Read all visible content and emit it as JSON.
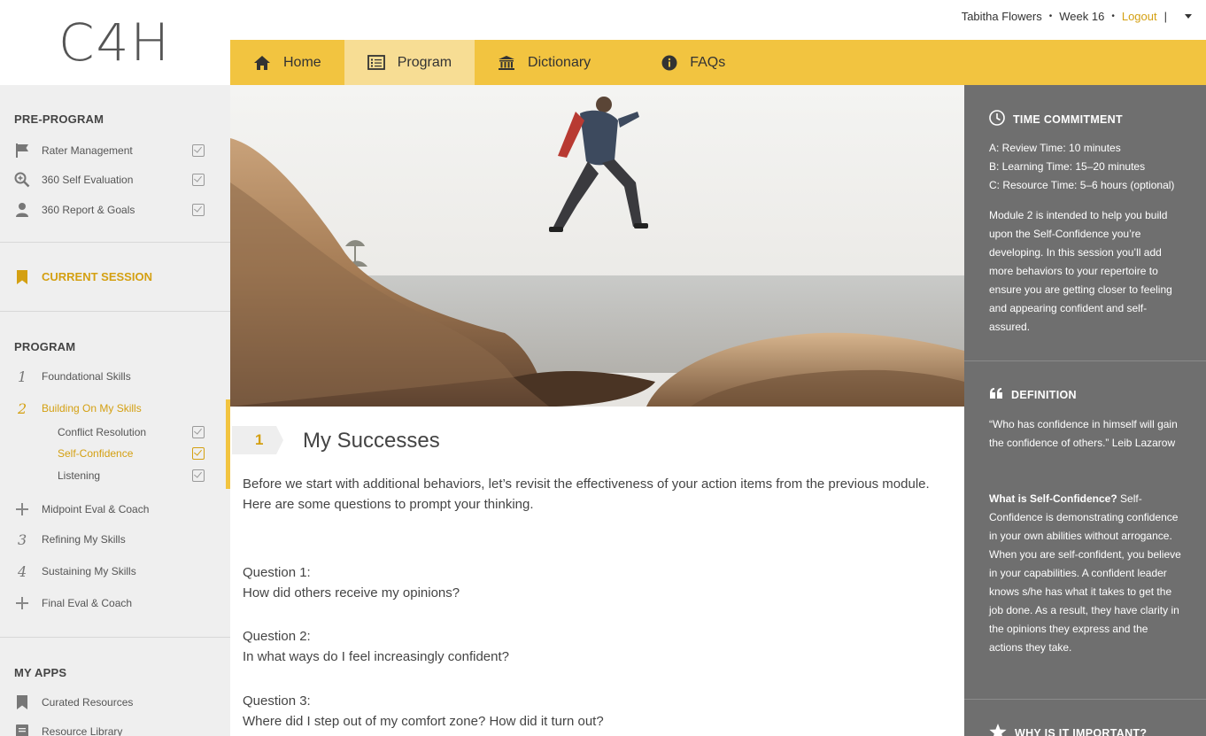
{
  "app": {
    "logo": "C4H"
  },
  "user": {
    "name": "Tabitha Flowers",
    "sep": "•",
    "week": "Week 16",
    "logout": "Logout",
    "pipe": "|"
  },
  "nav": {
    "tabs": [
      {
        "label": "Home",
        "icon": "home-icon"
      },
      {
        "label": "Program",
        "icon": "list-icon",
        "active": true
      },
      {
        "label": "Dictionary",
        "icon": "museum-icon"
      },
      {
        "label": "FAQs",
        "icon": "info-icon"
      }
    ]
  },
  "sidebar": {
    "pre_program": {
      "title": "PRE-PROGRAM",
      "items": [
        {
          "label": "Rater Management",
          "icon": "flag-icon",
          "done": true
        },
        {
          "label": "360 Self Evaluation",
          "icon": "magnifier-icon",
          "done": true
        },
        {
          "label": "360 Report & Goals",
          "icon": "person-icon",
          "done": true
        }
      ]
    },
    "current_session": "CURRENT SESSION",
    "program": {
      "title": "PROGRAM",
      "items": [
        {
          "num": "1",
          "label": "Foundational Skills"
        },
        {
          "num": "2",
          "label": "Building On My Skills",
          "active": true,
          "subitems": [
            {
              "label": "Conflict Resolution",
              "done": true
            },
            {
              "label": "Self-Confidence",
              "done": true,
              "active": true
            },
            {
              "label": "Listening",
              "done": true
            }
          ]
        },
        {
          "num": "+",
          "label": "Midpoint Eval & Coach"
        },
        {
          "num": "3",
          "label": "Refining My Skills"
        },
        {
          "num": "4",
          "label": "Sustaining My Skills"
        },
        {
          "num": "+",
          "label": "Final Eval & Coach"
        }
      ]
    },
    "my_apps": {
      "title": "MY APPS",
      "items": [
        {
          "label": "Curated Resources",
          "icon": "bookmark-icon"
        },
        {
          "label": "Resource Library",
          "icon": "book-icon"
        }
      ]
    }
  },
  "main": {
    "section_number": "1",
    "section_title": "My Successes",
    "intro": "Before we start with additional behaviors, let’s revisit the effectiveness of your action items from the previous module. Here are some questions to prompt your thinking.",
    "questions": [
      {
        "label": "Question 1:",
        "text": "How did others receive my opinions?"
      },
      {
        "label": "Question 2:",
        "text": "In what ways do I feel increasingly confident?"
      },
      {
        "label": "Question 3:",
        "text": "Where did I step out of my comfort zone? How did it turn out?"
      }
    ]
  },
  "panel": {
    "time": {
      "title": "TIME COMMITMENT",
      "lines": [
        "A: Review Time: 10 minutes",
        "B: Learning Time: 15–20 minutes",
        "C: Resource Time: 5–6 hours (optional)"
      ],
      "desc": "Module 2 is intended to help you build upon the Self-Confidence you’re developing. In this session you’ll add more behaviors to your repertoire to ensure you are getting closer to feeling and appearing confident and self-assured."
    },
    "definition": {
      "title": "DEFINITION",
      "quote": "“Who has confidence in himself will gain the confidence of others.” Leib Lazarow",
      "what_label": "What is Self-Confidence?",
      "what_text": " Self-Confidence is demonstrating confidence in your own abilities without arrogance. When you are self-confident, you believe in your capabilities. A confident leader knows s/he has what it takes to get the job done. As a result, they have clarity in the opinions they express and the actions they take."
    },
    "why": {
      "title": "WHY IS IT IMPORTANT?"
    }
  },
  "colors": {
    "accent": "#f2c440",
    "accent_text": "#d4a012",
    "panel_bg": "#6f6f6f",
    "sidebar_bg": "#efefef"
  }
}
